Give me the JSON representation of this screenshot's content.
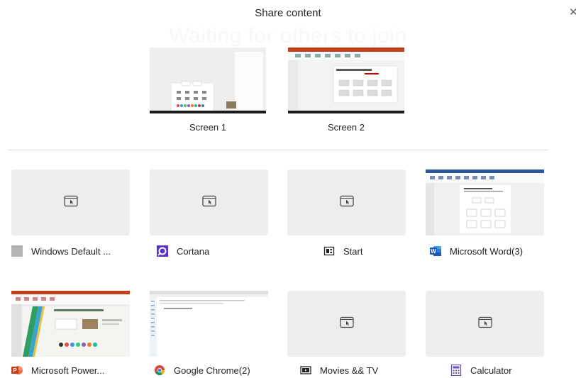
{
  "dialog": {
    "title": "Share content",
    "background_text": "Waiting for others to join",
    "close_symbol": "✕"
  },
  "screens": [
    {
      "label": "Screen 1",
      "icon": "desktop-preview"
    },
    {
      "label": "Screen 2",
      "icon": "desktop-preview"
    }
  ],
  "apps": [
    {
      "label": "Windows Default ...",
      "icon": "gray-square-icon"
    },
    {
      "label": "Cortana",
      "icon": "cortana-icon"
    },
    {
      "label": "Start",
      "icon": "start-icon"
    },
    {
      "label": "Microsoft Word(3)",
      "icon": "word-icon"
    },
    {
      "label": "Microsoft Power...",
      "icon": "powerpoint-icon"
    },
    {
      "label": "Google Chrome(2)",
      "icon": "chrome-icon"
    },
    {
      "label": "Movies && TV",
      "icon": "movies-tv-icon"
    },
    {
      "label": "Calculator",
      "icon": "calculator-icon"
    }
  ],
  "colors": {
    "accent": "#6264a7",
    "word": "#2b579a",
    "powerpoint": "#d24726",
    "tile": "#ededed"
  }
}
